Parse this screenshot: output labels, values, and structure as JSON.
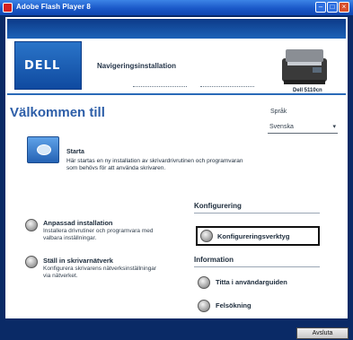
{
  "window": {
    "title": "Adobe Flash Player 8"
  },
  "header": {
    "logo": "DELL",
    "subtitle": "Navigeringsinstallation",
    "printer_label": "Dell 5110cn"
  },
  "welcome": {
    "title": "Välkommen till",
    "language_label": "Språk",
    "language_value": "Svenska"
  },
  "start": {
    "title": "Starta",
    "description": "Här startas en ny installation av skrivardrivrutinen och programvaran som behövs för att använda skrivaren."
  },
  "left_options": [
    {
      "label": "Anpassad installation",
      "description": "Installera drivrutiner och programvara med valbara inställningar."
    },
    {
      "label": "Ställ in skrivarnätverk",
      "description": "Konfigurera skrivarens nätverksinställningar via nätverket."
    }
  ],
  "configuration": {
    "heading": "Konfigurering",
    "option": "Konfigureringsverktyg"
  },
  "information": {
    "heading": "Information",
    "options": [
      "Titta i användarguiden",
      "Felsökning"
    ]
  },
  "footer": {
    "close_label": "Avsluta"
  }
}
